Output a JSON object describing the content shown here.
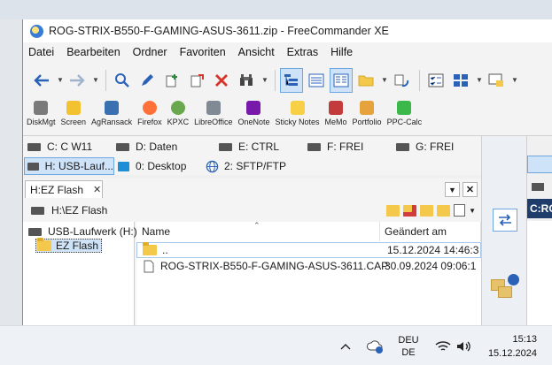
{
  "window": {
    "title": "ROG-STRIX-B550-F-GAMING-ASUS-3611.zip - FreeCommander XE"
  },
  "menu": [
    "Datei",
    "Bearbeiten",
    "Ordner",
    "Favoriten",
    "Ansicht",
    "Extras",
    "Hilfe"
  ],
  "apps": [
    {
      "label": "DiskMgt",
      "color": "#7a7a7a"
    },
    {
      "label": "Screen",
      "color": "#f2c230"
    },
    {
      "label": "AgRansack",
      "color": "#3a6fb0"
    },
    {
      "label": "Firefox",
      "color": "#ff7139"
    },
    {
      "label": "KPXC",
      "color": "#6aa84f"
    },
    {
      "label": "LibreOffice",
      "color": "#7f8a95"
    },
    {
      "label": "OneNote",
      "color": "#7719aa"
    },
    {
      "label": "Sticky Notes",
      "color": "#f7d046"
    },
    {
      "label": "MeMo",
      "color": "#c43b3b"
    },
    {
      "label": "Portfolio",
      "color": "#e6a23c"
    },
    {
      "label": "PPC-Calc",
      "color": "#3cb84a"
    }
  ],
  "drives_left": [
    {
      "label": "C: C W11"
    },
    {
      "label": "D: Daten"
    },
    {
      "label": "E: CTRL"
    },
    {
      "label": "F: FREI"
    },
    {
      "label": "G: FREI"
    },
    {
      "label": "H: USB-Lauf..."
    },
    {
      "label": "0: Desktop"
    },
    {
      "label": "2: SFTP/FTP"
    }
  ],
  "left_panel": {
    "tab_label": "H:EZ Flash",
    "tab_close": "✕",
    "path": "H:\\EZ Flash",
    "tree": [
      {
        "label": "USB-Laufwerk (H:)"
      },
      {
        "label": "EZ Flash"
      }
    ],
    "columns": {
      "name": "Name",
      "modified": "Geändert am"
    },
    "rows": [
      {
        "name": "..",
        "date": "15.12.2024 14:46:3"
      },
      {
        "name": "ROG-STRIX-B550-F-GAMING-ASUS-3611.CAP",
        "date": "30.09.2024 09:06:1"
      }
    ]
  },
  "right_panel": {
    "drive_label": "C:RO"
  },
  "taskbar": {
    "lang_top": "DEU",
    "lang_bottom": "DE",
    "time": "15:13",
    "date": "15.12.2024"
  }
}
